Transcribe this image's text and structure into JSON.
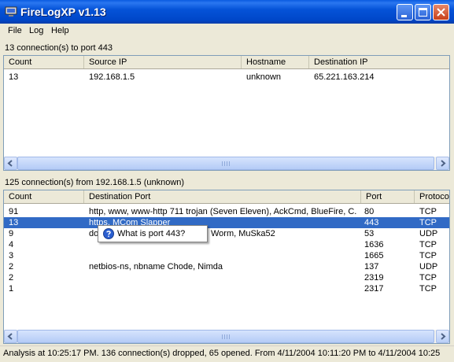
{
  "window": {
    "title": "FireLogXP v1.13"
  },
  "menu": [
    "File",
    "Log",
    "Help"
  ],
  "top": {
    "summary": "13 connection(s) to port 443",
    "columns": [
      "Count",
      "Source IP",
      "Hostname",
      "Destination IP"
    ],
    "rows": [
      {
        "count": "13",
        "source_ip": "192.168.1.5",
        "hostname": "unknown",
        "dest_ip": "65.221.163.214"
      }
    ]
  },
  "bottom": {
    "summary": "125 connection(s) from 192.168.1.5 (unknown)",
    "columns": [
      "Count",
      "Destination Port",
      "Port",
      "Protocol"
    ],
    "rows": [
      {
        "count": "91",
        "desc": "http, www, www-http 711 trojan (Seven Eleven), AckCmd, BlueFire, C...",
        "port": "80",
        "protocol": "TCP"
      },
      {
        "count": "13",
        "desc": "https, MCom Slapper",
        "port": "443",
        "protocol": "TCP"
      },
      {
        "count": "9",
        "desc": "do",
        "desc_tail": "Worm, MuSka52",
        "port": "53",
        "protocol": "UDP"
      },
      {
        "count": "4",
        "desc": "",
        "port": "1636",
        "protocol": "TCP"
      },
      {
        "count": "3",
        "desc": "",
        "port": "1665",
        "protocol": "TCP"
      },
      {
        "count": "2",
        "desc": "netbios-ns, nbname Chode, Nimda",
        "port": "137",
        "protocol": "UDP"
      },
      {
        "count": "2",
        "desc": "",
        "port": "2319",
        "protocol": "TCP"
      },
      {
        "count": "1",
        "desc": "",
        "port": "2317",
        "protocol": "TCP"
      }
    ]
  },
  "context_menu": {
    "item": "What is port 443?",
    "icon": "help-icon"
  },
  "status": "Analysis at 10:25:17 PM. 136 connection(s) dropped, 65 opened. From 4/11/2004 10:11:20 PM to 4/11/2004 10:25",
  "colors": {
    "titlebar": "#0553d8",
    "selection": "#316ac5",
    "pane_border": "#7f9db9"
  }
}
